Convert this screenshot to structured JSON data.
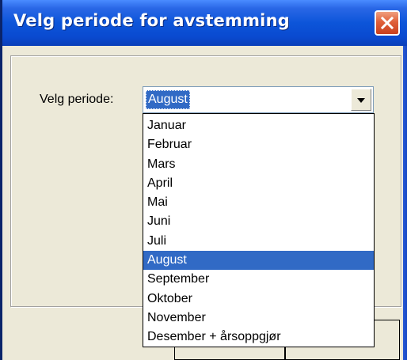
{
  "window": {
    "title": "Velg periode for avstemming"
  },
  "form": {
    "period_label": "Velg periode:",
    "selected_value": "August"
  },
  "dropdown": {
    "options": [
      "Januar",
      "Februar",
      "Mars",
      "April",
      "Mai",
      "Juni",
      "Juli",
      "August",
      "September",
      "Oktober",
      "November",
      "Desember + årsoppgjør"
    ],
    "selected_index": 7
  },
  "colors": {
    "titlebar": "#0a4ad0",
    "selection": "#316ac5",
    "close_button": "#e0603a",
    "dialog_background": "#ece9d8"
  },
  "icons": {
    "close": "close-icon",
    "dropdown": "chevron-down-icon"
  }
}
